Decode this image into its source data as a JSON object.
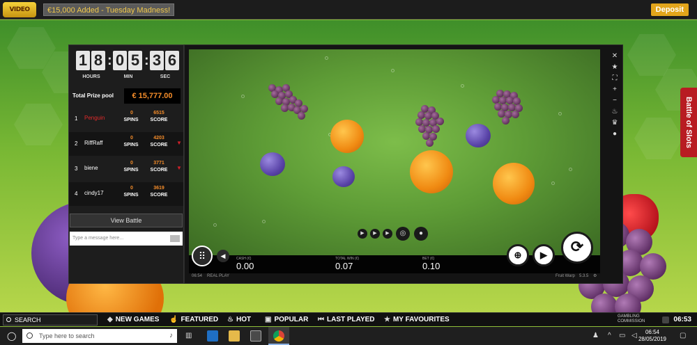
{
  "topbar": {
    "logo": "VIDEO SLOTS",
    "promo": "€15,000 Added - Tuesday Madness!",
    "deposit": "Deposit"
  },
  "battle_tab": "Battle of Slots",
  "timer": {
    "hours": [
      "1",
      "8"
    ],
    "minutes": [
      "0",
      "5"
    ],
    "seconds": [
      "3",
      "6"
    ],
    "hours_label": "HOURS",
    "minutes_label": "MIN",
    "seconds_label": "SEC"
  },
  "prize": {
    "label": "Total Prize pool",
    "value": "€ 15,777.00"
  },
  "leaderboard": {
    "spins_label": "SPINS",
    "score_label": "SCORE",
    "rows": [
      {
        "rank": "1",
        "name": "Penguin",
        "spins": "0",
        "score": "6515"
      },
      {
        "rank": "2",
        "name": "RiffRaff",
        "spins": "0",
        "score": "4203"
      },
      {
        "rank": "3",
        "name": "biene",
        "spins": "0",
        "score": "3771"
      },
      {
        "rank": "4",
        "name": "cindy17",
        "spins": "0",
        "score": "3619"
      }
    ]
  },
  "view_battle": "View Battle",
  "message_placeholder": "Type a message here...",
  "hud": {
    "cash_label": "CASH (€)",
    "cash": "0.00",
    "total_win_label": "TOTAL WIN (€)",
    "total_win": "0.07",
    "bet_label": "BET (€)",
    "bet": "0.10"
  },
  "footer": {
    "time": "06:54",
    "mode": "REAL PLAY",
    "game": "Fruit Warp",
    "version": "5.3.5"
  },
  "navbar": {
    "search": "SEARCH",
    "items": [
      "NEW GAMES",
      "FEATURED",
      "HOT",
      "POPULAR",
      "LAST PLAYED",
      "MY FAVOURITES"
    ],
    "gambling": "GAMBLING COMMISSION",
    "time": "06:53"
  },
  "taskbar": {
    "search_placeholder": "Type here to search",
    "time": "06:54",
    "date": "28/05/2019"
  },
  "colors": {
    "accent": "#f58d2a",
    "deposit": "#e3a51b",
    "battle": "#b81c22"
  }
}
